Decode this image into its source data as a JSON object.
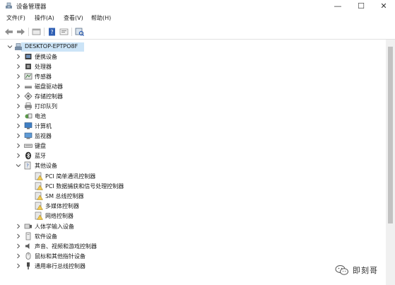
{
  "window": {
    "title": "设备管理器",
    "controls": {
      "minimize": "—",
      "maximize": "☐",
      "close": "✕"
    }
  },
  "menubar": {
    "items": [
      "文件(F)",
      "操作(A)",
      "查看(V)",
      "帮助(H)"
    ]
  },
  "toolbar": {
    "buttons": [
      "back",
      "forward",
      "properties",
      "help",
      "update-driver",
      "scan"
    ]
  },
  "tree": {
    "root": "DESKTOP-EPTPO8F",
    "categories": [
      {
        "label": "便携设备",
        "icon": "portable-device-icon"
      },
      {
        "label": "处理器",
        "icon": "processor-icon"
      },
      {
        "label": "传感器",
        "icon": "sensor-icon"
      },
      {
        "label": "磁盘驱动器",
        "icon": "disk-drive-icon"
      },
      {
        "label": "存储控制器",
        "icon": "storage-controller-icon"
      },
      {
        "label": "打印队列",
        "icon": "printer-icon"
      },
      {
        "label": "电池",
        "icon": "battery-icon"
      },
      {
        "label": "计算机",
        "icon": "computer-icon"
      },
      {
        "label": "监视器",
        "icon": "monitor-icon"
      },
      {
        "label": "键盘",
        "icon": "keyboard-icon"
      },
      {
        "label": "蓝牙",
        "icon": "bluetooth-icon"
      },
      {
        "label": "其他设备",
        "icon": "other-devices-icon",
        "expanded": true
      },
      {
        "label": "人体学输入设备",
        "icon": "hid-icon"
      },
      {
        "label": "软件设备",
        "icon": "software-device-icon"
      },
      {
        "label": "声音、视频和游戏控制器",
        "icon": "sound-icon"
      },
      {
        "label": "鼠标和其他指针设备",
        "icon": "mouse-icon"
      },
      {
        "label": "通用串行总线控制器",
        "icon": "usb-icon"
      }
    ],
    "other_devices_children": [
      "PCI 简单通讯控制器",
      "PCI 数据捕获和信号处理控制器",
      "SM 总线控制器",
      "多媒体控制器",
      "网络控制器"
    ]
  },
  "watermark": {
    "text": "即刻哥"
  },
  "colors": {
    "selection": "#cce4f7",
    "warning": "#f2c94c",
    "scrollbar_thumb": "#c2c2c2"
  }
}
